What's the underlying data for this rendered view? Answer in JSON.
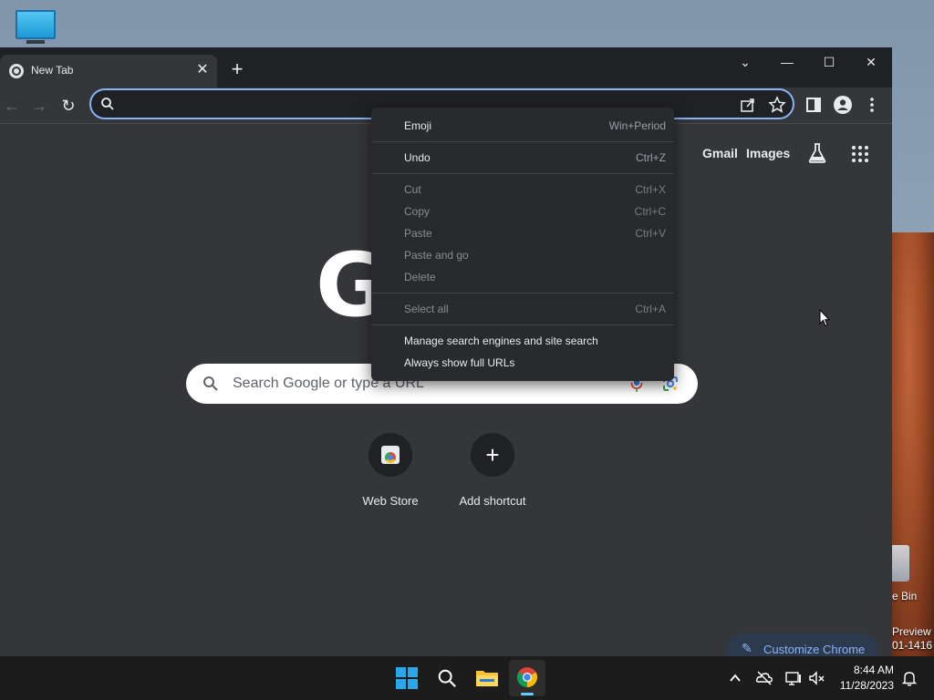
{
  "desktop": {
    "bin_label": "e Bin",
    "preview_line1": "Preview",
    "preview_line2": "01-1416"
  },
  "browser": {
    "tab_title": "New Tab",
    "tab_close": "✕",
    "new_tab": "+",
    "window_controls": {
      "dropdown": "⌄",
      "minimize": "—",
      "maximize": "☐",
      "close": "✕"
    },
    "nav": {
      "back": "←",
      "forward": "→",
      "reload": "↻"
    },
    "omnibox_value": ""
  },
  "ntp": {
    "gmail": "Gmail",
    "images": "Images",
    "logo_partial": "G",
    "search_placeholder": "Search Google or type a URL",
    "shortcuts": [
      {
        "label": "Web Store"
      },
      {
        "label": "Add shortcut",
        "icon": "+"
      }
    ],
    "customize_label": "Customize Chrome",
    "customize_icon": "✎"
  },
  "context_menu": {
    "items": [
      {
        "label": "Emoji",
        "shortcut": "Win+Period",
        "enabled": true
      },
      {
        "label": "Undo",
        "shortcut": "Ctrl+Z",
        "enabled": true
      },
      {
        "label": "Cut",
        "shortcut": "Ctrl+X",
        "enabled": false
      },
      {
        "label": "Copy",
        "shortcut": "Ctrl+C",
        "enabled": false
      },
      {
        "label": "Paste",
        "shortcut": "Ctrl+V",
        "enabled": false
      },
      {
        "label": "Paste and go",
        "shortcut": "",
        "enabled": false
      },
      {
        "label": "Delete",
        "shortcut": "",
        "enabled": false
      },
      {
        "label": "Select all",
        "shortcut": "Ctrl+A",
        "enabled": false
      },
      {
        "label": "Manage search engines and site search",
        "shortcut": "",
        "enabled": true
      },
      {
        "label": "Always show full URLs",
        "shortcut": "",
        "enabled": true
      }
    ]
  },
  "taskbar": {
    "time": "8:44 AM",
    "date": "11/28/2023"
  },
  "colors": {
    "accent": "#8ab4f8",
    "taskbar_indicator": "#60cdff",
    "window_bg": "#35363a",
    "titlebar_bg": "#202124",
    "menu_bg": "#292a2d"
  }
}
